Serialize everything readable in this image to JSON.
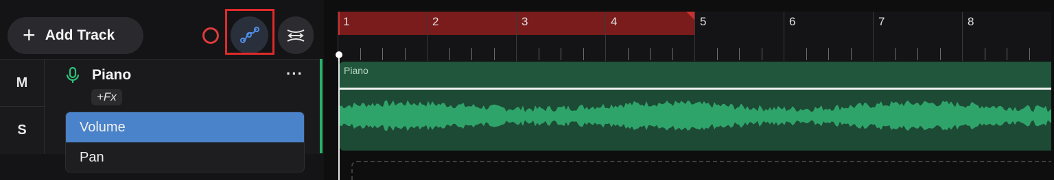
{
  "toolbar": {
    "add_track_label": "Add Track",
    "add_icon": "plus",
    "record_icon": "record-circle",
    "automation_icon": "automation-curve",
    "snap_icon": "snap-arrows"
  },
  "ruler": {
    "bars": [
      "1",
      "2",
      "3",
      "4",
      "5",
      "6",
      "7",
      "8"
    ],
    "loop_region_color": "#7a1c1c"
  },
  "track": {
    "mute_label": "M",
    "solo_label": "S",
    "name": "Piano",
    "fx_label": "+Fx",
    "more_label": "···",
    "color": "#27b36a",
    "clip_label": "Piano"
  },
  "automation_menu": {
    "items": [
      {
        "label": "Volume",
        "selected": true
      },
      {
        "label": "Pan",
        "selected": false
      }
    ],
    "selected_color": "#4a83c9"
  },
  "annotation": {
    "highlight_color": "#e02a2a"
  }
}
